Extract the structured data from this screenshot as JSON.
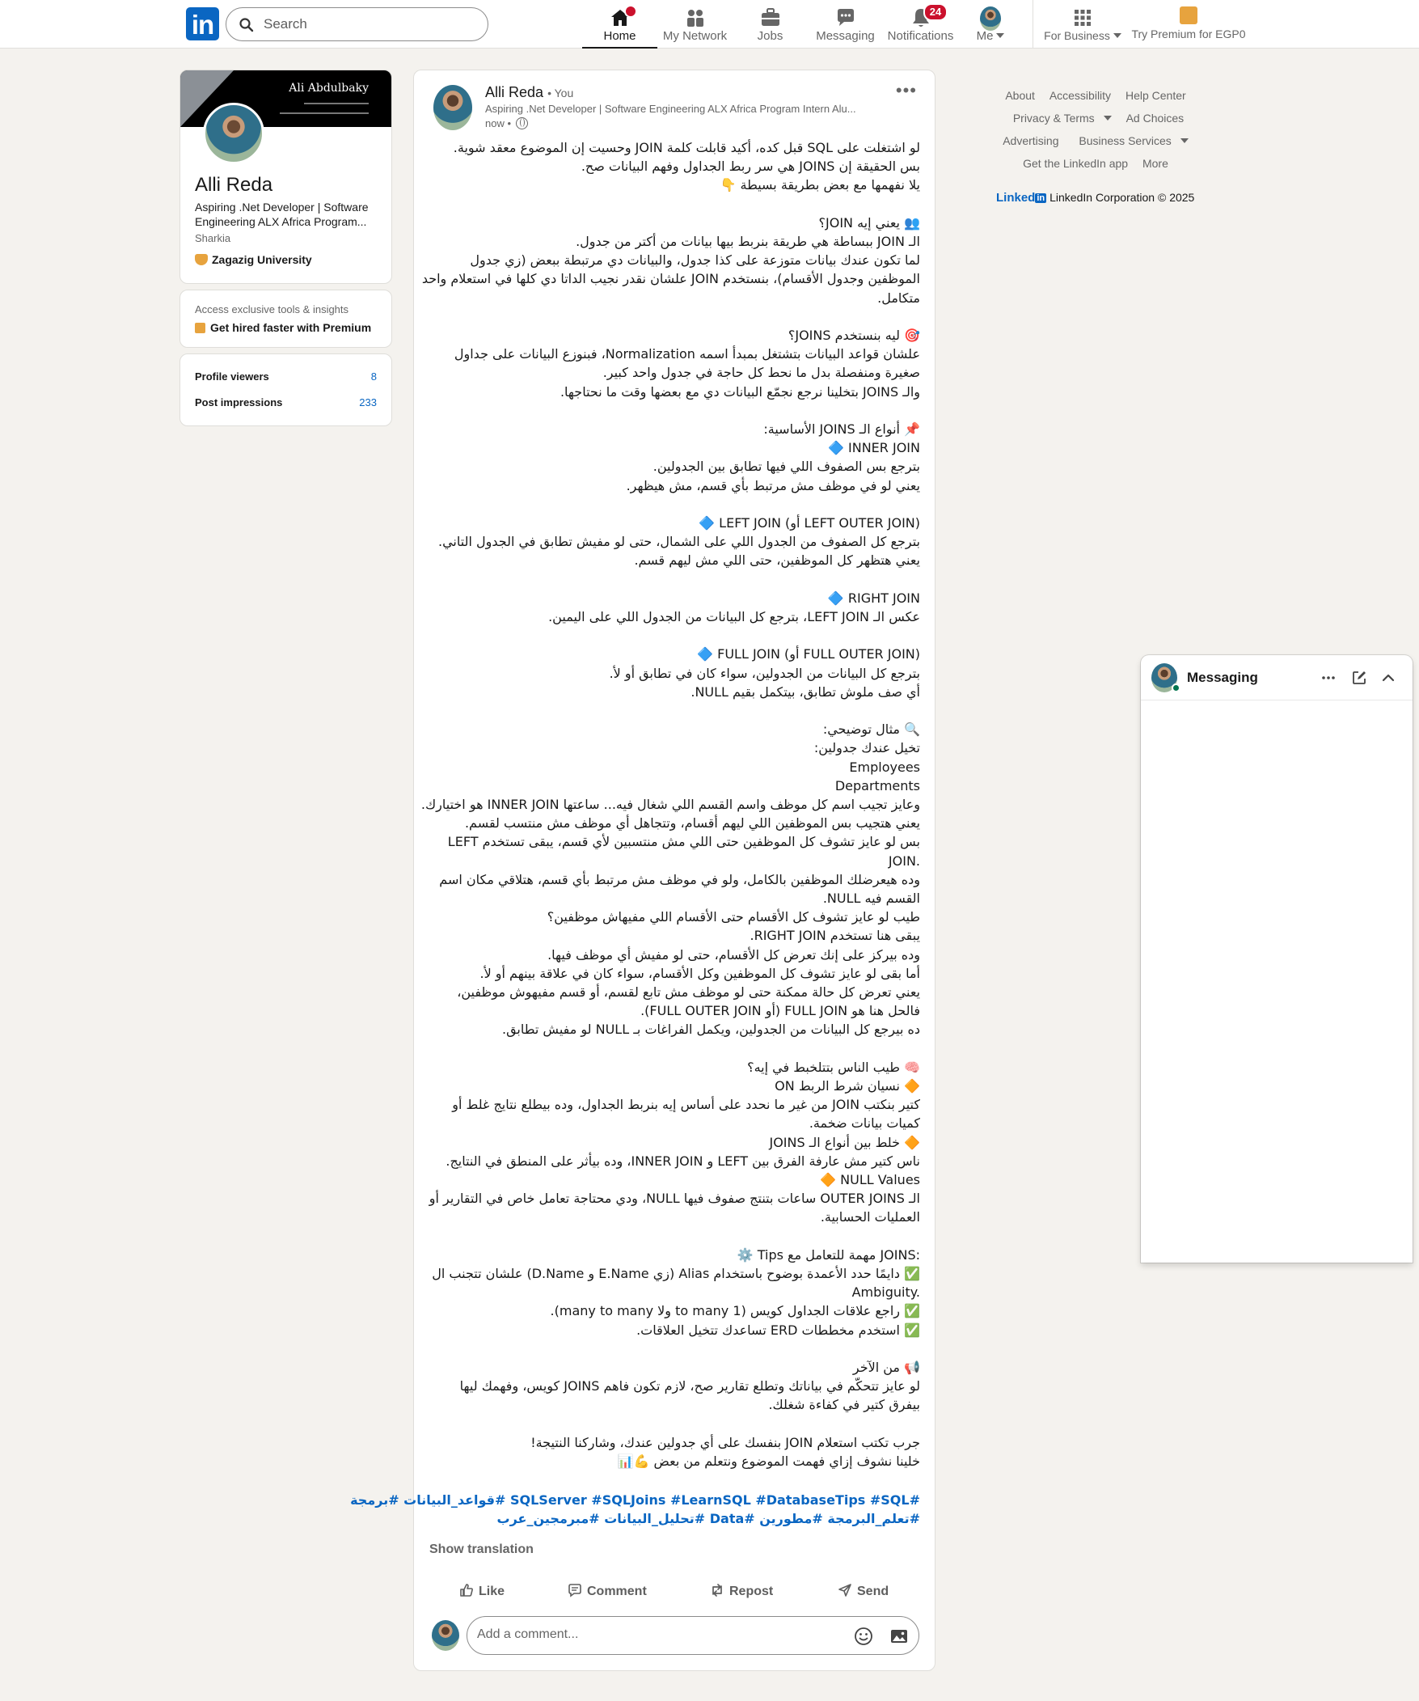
{
  "nav": {
    "logo": "in",
    "search_placeholder": "Search",
    "items": [
      {
        "label": "Home",
        "icon": "home-icon",
        "badge": ""
      },
      {
        "label": "My Network",
        "icon": "network-icon",
        "badge": ""
      },
      {
        "label": "Jobs",
        "icon": "briefcase-icon",
        "badge": ""
      },
      {
        "label": "Messaging",
        "icon": "chat-icon",
        "badge": ""
      },
      {
        "label": "Notifications",
        "icon": "bell-icon",
        "badge": "24"
      },
      {
        "label": "Me",
        "icon": "avatar-icon",
        "badge": ""
      }
    ],
    "business": "For Business",
    "premium": "Try Premium for EGP0"
  },
  "profile": {
    "banner_name": "Ali Abdulbaky",
    "name": "Alli Reda",
    "headline": "Aspiring .Net Developer | Software Engineering ALX Africa Program...",
    "location": "Sharkia",
    "university": "Zagazig University"
  },
  "premium_card": {
    "teaser": "Access exclusive tools & insights",
    "cta": "Get hired faster with Premium"
  },
  "stats": {
    "viewers_label": "Profile viewers",
    "viewers_value": "8",
    "impressions_label": "Post impressions",
    "impressions_value": "233"
  },
  "post": {
    "author": "Alli Reda",
    "you": "• You",
    "headline": "Aspiring .Net Developer | Software Engineering ALX Africa Program Intern Alu...",
    "time": "now •",
    "lines": [
      "لو اشتغلت على SQL قبل كده، أكيد قابلت كلمة JOIN وحسيت إن الموضوع معقد شوية.",
      "بس الحقيقة إن JOINS هي سر ربط الجداول وفهم البيانات صح.",
      "يلا نفهمها مع بعض بطريقة بسيطة 👇",
      "",
      "👥 يعني إيه JOIN؟",
      "الـ JOIN ببساطة هي طريقة بنربط بيها بيانات من أكتر من جدول.",
      "لما تكون عندك بيانات متوزعة على كذا جدول، والبيانات دي مرتبطة ببعض (زي جدول",
      "الموظفين وجدول الأقسام)، بنستخدم JOIN علشان نقدر نجيب الداتا دي كلها في استعلام واحد",
      "متكامل.",
      "",
      "🎯 ليه بنستخدم JOINS؟",
      "علشان قواعد البيانات بتشتغل بمبدأ اسمه Normalization، فبنوزع البيانات على جداول",
      "صغيرة ومنفصلة بدل ما نحط كل حاجة في جدول واحد كبير.",
      "والـ JOINS بتخلينا نرجع نجمّع البيانات دي مع بعضها وقت ما نحتاجها.",
      "",
      "📌 أنواع الـ JOINS الأساسية:",
      "🔷 INNER JOIN",
      "بترجع بس الصفوف اللي فيها تطابق بين الجدولين.",
      "يعني لو في موظف مش مرتبط بأي قسم، مش هيظهر.",
      "",
      "🔷 LEFT JOIN (أو LEFT OUTER JOIN)",
      "بترجع كل الصفوف من الجدول اللي على الشمال، حتى لو مفيش تطابق في الجدول التاني.",
      "يعني هتظهر كل الموظفين، حتى اللي مش ليهم قسم.",
      "",
      "🔷 RIGHT JOIN",
      "عكس الـ LEFT JOIN، بترجع كل البيانات من الجدول اللي على اليمين.",
      "",
      "🔷 FULL JOIN (أو FULL OUTER JOIN)",
      "بترجع كل البيانات من الجدولين، سواء كان في تطابق أو لأ.",
      "أي صف ملوش تطابق، بيتكمل بقيم NULL.",
      "",
      "🔍 مثال توضيحي:",
      "تخيل عندك جدولين:",
      "Employees",
      "Departments",
      "وعايز تجيب اسم كل موظف واسم القسم اللي شغال فيه... ساعتها INNER JOIN هو اختيارك.",
      "يعني هتجيب بس الموظفين اللي ليهم أقسام، وتتجاهل أي موظف مش منتسب لقسم.",
      "بس لو عايز تشوف كل الموظفين حتى اللي مش منتسبين لأي قسم، يبقى تستخدم LEFT",
      "JOIN.",
      "وده هيعرضلك الموظفين بالكامل، ولو في موظف مش مرتبط بأي قسم، هتلاقي مكان اسم",
      "القسم فيه NULL.",
      "طيب لو عايز تشوف كل الأقسام حتى الأقسام اللي مفيهاش موظفين؟",
      "يبقى هنا تستخدم RIGHT JOIN.",
      "وده بيركز على إنك تعرض كل الأقسام، حتى لو مفيش أي موظف فيها.",
      "أما بقى لو عايز تشوف كل الموظفين وكل الأقسام، سواء كان في علاقة بينهم أو لأ.",
      "يعني تعرض كل حالة ممكنة حتى لو موظف مش تابع لقسم، أو قسم مفيهوش موظفين،",
      "فالحل هنا هو FULL JOIN (أو FULL OUTER JOIN).",
      "ده بيرجع كل البيانات من الجدولين، ويكمل الفراغات بـ NULL لو مفيش تطابق.",
      "",
      "🧠 طيب الناس بتتلخبط في إيه؟",
      "🔶 نسيان شرط الربط ON",
      "كتير بنكتب JOIN من غير ما نحدد على أساس إيه بنربط الجداول، وده بيطلع نتايج غلط أو",
      "كميات بيانات ضخمة.",
      "🔶 خلط بين أنواع الـ JOINS",
      "ناس كتير مش عارفة الفرق بين LEFT و INNER JOIN، وده بيأثر على المنطق في النتايج.",
      "🔶 NULL Values",
      "الـ OUTER JOINS ساعات بتنتج صفوف فيها NULL، ودي محتاجة تعامل خاص في التقارير أو",
      "العمليات الحسابية.",
      "",
      "⚙️ Tips مهمة للتعامل مع JOINS:",
      "✅ دايمًا حدد الأعمدة بوضوح باستخدام Alias (زي E.Name و D.Name) علشان تتجنب ال",
      "Ambiguity.",
      "✅ راجع علاقات الجداول كويس (1 to many ولا many to many).",
      "✅ استخدم مخططات ERD تساعدك تتخيل العلاقات.",
      "",
      "📢 من الآخر",
      "لو عايز تتحكّم في بياناتك وتطلع تقارير صح، لازم تكون فاهم JOINS كويس، وفهمك ليها",
      "بيفرق كتير في كفاءة شغلك.",
      "",
      "جرب تكتب استعلام JOIN بنفسك على أي جدولين عندك، وشاركنا النتيجة!",
      "خلينا نشوف إزاي فهمت الموضوع ونتعلم من بعض 💪📊"
    ],
    "hashtags": [
      "#SQLServer #SQLJoins #LearnSQL #DatabaseTips #SQL #قواعد_البيانات #برمجة",
      "#تعلم_البرمجة #مطورين #Data #تحليل_البيانات #مبرمجين_عرب"
    ],
    "show_translation": "Show translation",
    "actions": {
      "like": "Like",
      "comment": "Comment",
      "repost": "Repost",
      "send": "Send"
    },
    "comment_placeholder": "Add a comment..."
  },
  "footer": {
    "row1": [
      "About",
      "Accessibility",
      "Help Center"
    ],
    "row2": [
      "Privacy & Terms",
      "Ad Choices"
    ],
    "row3": [
      "Advertising",
      "Business Services"
    ],
    "row4": [
      "Get the LinkedIn app",
      "More"
    ],
    "brand": "Linked",
    "brand_in": "in",
    "copyright": "LinkedIn Corporation © 2025"
  },
  "messaging": {
    "title": "Messaging"
  },
  "colors": {
    "brand": "#0a66c2",
    "badge": "#cb112d",
    "background": "#f4f2ee"
  }
}
